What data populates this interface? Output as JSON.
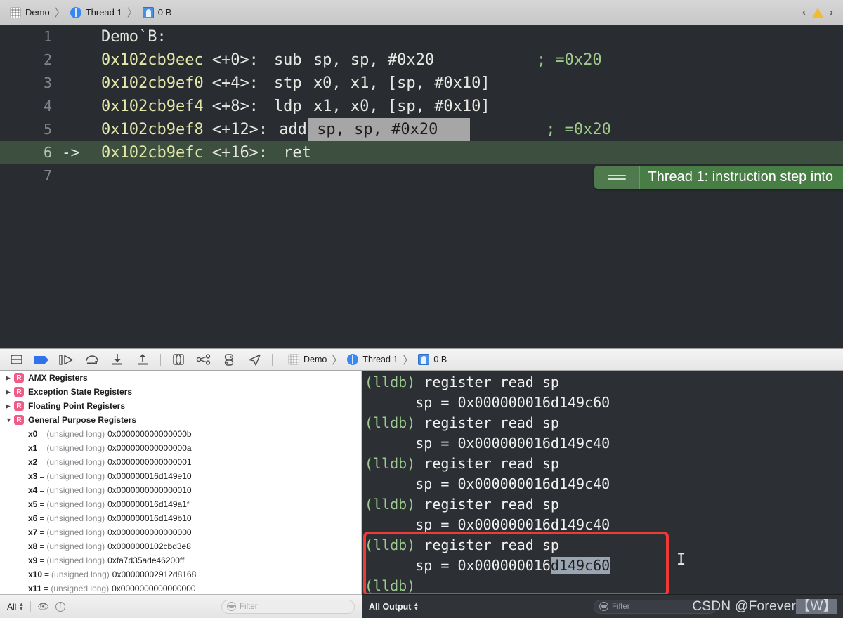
{
  "jump_bar": {
    "project": "Demo",
    "thread": "Thread 1",
    "frame": "0 B",
    "separator": "〉",
    "icons": {
      "project": "grid-icon",
      "thread": "thread-icon",
      "frame": "stack-frame-icon"
    },
    "nav_back": "‹",
    "nav_forward": "›",
    "warning": "warning-triangle-icon"
  },
  "editor": {
    "lines": [
      {
        "num": "1",
        "arrow": "",
        "current": false,
        "symbol": "Demo`B:",
        "address": "",
        "offset": "",
        "mnemonic": "",
        "operands": "",
        "comment": ""
      },
      {
        "num": "2",
        "arrow": "",
        "current": false,
        "symbol": "",
        "address": "0x102cb9eec",
        "offset": "<+0>:",
        "mnemonic": "sub",
        "operands": "sp, sp, #0x20",
        "comment": "; =0x20"
      },
      {
        "num": "3",
        "arrow": "",
        "current": false,
        "symbol": "",
        "address": "0x102cb9ef0",
        "offset": "<+4>:",
        "mnemonic": "stp",
        "operands": "x0, x1, [sp, #0x10]",
        "comment": ""
      },
      {
        "num": "4",
        "arrow": "",
        "current": false,
        "symbol": "",
        "address": "0x102cb9ef4",
        "offset": "<+8>:",
        "mnemonic": "ldp",
        "operands": "x1, x0, [sp, #0x10]",
        "comment": ""
      },
      {
        "num": "5",
        "arrow": "",
        "current": false,
        "symbol": "",
        "address": "0x102cb9ef8",
        "offset": "<+12>:",
        "mnemonic": "add",
        "operands": "sp, sp, #0x20",
        "comment": "; =0x20",
        "selected": true
      },
      {
        "num": "6",
        "arrow": "->",
        "current": true,
        "symbol": "",
        "address": "0x102cb9efc",
        "offset": "<+16>:",
        "mnemonic": "ret",
        "operands": "",
        "comment": ""
      },
      {
        "num": "7",
        "arrow": "",
        "current": false,
        "symbol": "",
        "address": "",
        "offset": "",
        "mnemonic": "",
        "operands": "",
        "comment": ""
      }
    ],
    "issue_banner": {
      "text": "Thread 1: instruction step into",
      "color": "#497d46",
      "grip_icon": "drag-handle-icon"
    }
  },
  "debug_toolbar": {
    "buttons": [
      {
        "name": "hide-debug-area-button",
        "icon": "panel-toggle-icon"
      },
      {
        "name": "breakpoints-toggle-button",
        "icon": "breakpoint-flag-icon"
      },
      {
        "name": "continue-button",
        "icon": "continue-play-icon"
      },
      {
        "name": "step-over-button",
        "icon": "step-over-icon"
      },
      {
        "name": "step-into-button",
        "icon": "step-into-icon"
      },
      {
        "name": "step-out-button",
        "icon": "step-out-icon"
      },
      {
        "name": "debug-view-hierarchy-button",
        "icon": "view-hierarchy-icon"
      },
      {
        "name": "debug-memory-graph-button",
        "icon": "memory-graph-icon"
      },
      {
        "name": "environment-overrides-button",
        "icon": "environment-overrides-icon"
      },
      {
        "name": "simulate-location-button",
        "icon": "location-arrow-icon"
      }
    ],
    "breadcrumb": {
      "project": "Demo",
      "thread": "Thread 1",
      "frame": "0 B"
    }
  },
  "variables": {
    "groups": [
      {
        "label": "AMX Registers",
        "expanded": false,
        "badge": "R"
      },
      {
        "label": "Exception State Registers",
        "expanded": false,
        "badge": "R"
      },
      {
        "label": "Floating Point Registers",
        "expanded": false,
        "badge": "R"
      },
      {
        "label": "General Purpose Registers",
        "expanded": true,
        "badge": "R"
      }
    ],
    "registers": [
      {
        "name": "x0",
        "type": "(unsigned long)",
        "value": "0x000000000000000b"
      },
      {
        "name": "x1",
        "type": "(unsigned long)",
        "value": "0x000000000000000a"
      },
      {
        "name": "x2",
        "type": "(unsigned long)",
        "value": "0x0000000000000001"
      },
      {
        "name": "x3",
        "type": "(unsigned long)",
        "value": "0x000000016d149e10"
      },
      {
        "name": "x4",
        "type": "(unsigned long)",
        "value": "0x0000000000000010"
      },
      {
        "name": "x5",
        "type": "(unsigned long)",
        "value": "0x000000016d149a1f"
      },
      {
        "name": "x6",
        "type": "(unsigned long)",
        "value": "0x000000016d149b10"
      },
      {
        "name": "x7",
        "type": "(unsigned long)",
        "value": "0x0000000000000000"
      },
      {
        "name": "x8",
        "type": "(unsigned long)",
        "value": "0x0000000102cbd3e8"
      },
      {
        "name": "x9",
        "type": "(unsigned long)",
        "value": "0xfa7d35ade46200ff"
      },
      {
        "name": "x10",
        "type": "(unsigned long)",
        "value": "0x00000002912d8168"
      },
      {
        "name": "x11",
        "type": "(unsigned long)",
        "value": "0x0000000000000000"
      }
    ]
  },
  "console": {
    "lines": [
      {
        "type": "prompt",
        "prompt": "(lldb)",
        "text": " register read sp"
      },
      {
        "type": "output",
        "text": "      sp = 0x000000016d149c60"
      },
      {
        "type": "prompt",
        "prompt": "(lldb)",
        "text": " register read sp"
      },
      {
        "type": "output",
        "text": "      sp = 0x000000016d149c40"
      },
      {
        "type": "prompt",
        "prompt": "(lldb)",
        "text": " register read sp"
      },
      {
        "type": "output",
        "text": "      sp = 0x000000016d149c40"
      },
      {
        "type": "prompt",
        "prompt": "(lldb)",
        "text": " register read sp"
      },
      {
        "type": "output",
        "text": "      sp = 0x000000016d149c40"
      },
      {
        "type": "prompt",
        "prompt": "(lldb)",
        "text": " register read sp"
      },
      {
        "type": "output_hl",
        "text": "      sp = 0x000000016",
        "highlight": "d149c60"
      },
      {
        "type": "prompt",
        "prompt": "(lldb)",
        "text": ""
      }
    ],
    "highlight_box_color": "#f03a35",
    "cursor": "I"
  },
  "status_bar": {
    "scope_filter": "All",
    "stepper_up": "▲",
    "stepper_down": "▼",
    "eye_icon": "eye-icon",
    "info_icon": "info-icon",
    "filter_placeholder": "Filter",
    "output_filter": "All Output",
    "console_filter_placeholder": "Filter"
  },
  "watermark": {
    "prefix": "CSDN @Forever",
    "suffix": "【W】"
  }
}
